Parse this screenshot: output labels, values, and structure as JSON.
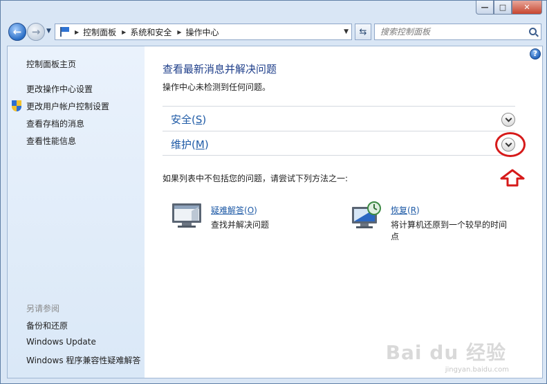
{
  "window": {
    "minimize": "—",
    "maximize": "□",
    "close": "✕"
  },
  "nav": {
    "back": "←",
    "forward": "→",
    "breadcrumb": [
      "控制面板",
      "系统和安全",
      "操作中心"
    ],
    "search_placeholder": "搜索控制面板"
  },
  "sidebar": {
    "home": "控制面板主页",
    "items": [
      "更改操作中心设置",
      "更改用户帐户控制设置",
      "查看存档的消息",
      "查看性能信息"
    ],
    "see_also_title": "另请参阅",
    "see_also": [
      "备份和还原",
      "Windows Update",
      "Windows 程序兼容性疑难解答"
    ]
  },
  "main": {
    "title": "查看最新消息并解决问题",
    "subtitle": "操作中心未检测到任何问题。",
    "sections": [
      {
        "label": "安全",
        "hotkey": "S"
      },
      {
        "label": "维护",
        "hotkey": "M"
      }
    ],
    "hint": "如果列表中不包括您的问题，请尝试下列方法之一:",
    "tools": [
      {
        "label": "疑难解答",
        "hotkey": "O",
        "desc": "查找并解决问题"
      },
      {
        "label": "恢复",
        "hotkey": "R",
        "desc": "将计算机还原到一个较早的时间点"
      }
    ]
  },
  "watermark": {
    "text": "Bai du 经验",
    "sub": "jingyan.baidu.com"
  },
  "colors": {
    "accent": "#1e5aa6",
    "title": "#1e3e8a",
    "annotation": "#d61a1a"
  }
}
